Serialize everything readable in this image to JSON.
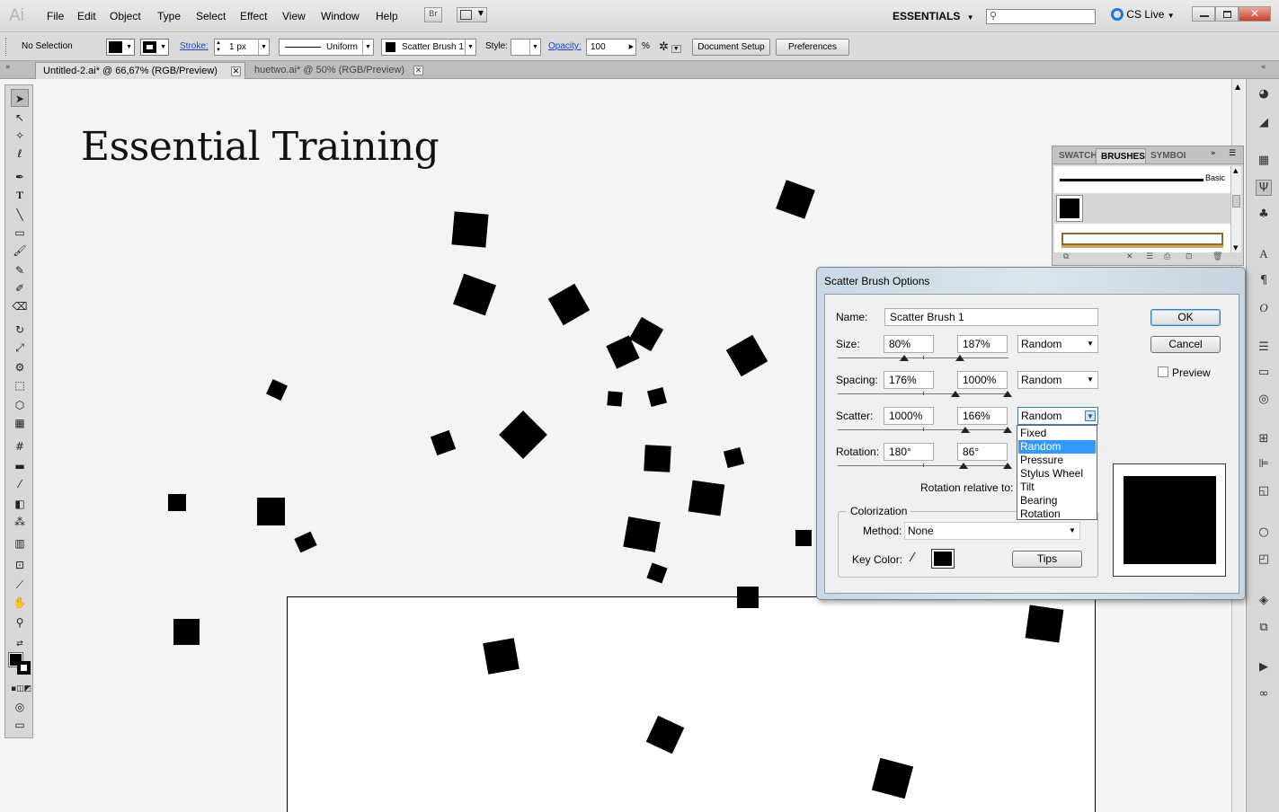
{
  "app": {
    "logo": "Ai"
  },
  "menu": [
    "File",
    "Edit",
    "Object",
    "Type",
    "Select",
    "Effect",
    "View",
    "Window",
    "Help"
  ],
  "menu_right": {
    "bridge": "Br",
    "workspace": "ESSENTIALS",
    "search_placeholder": "",
    "cslive": "CS Live"
  },
  "control": {
    "selection": "No Selection",
    "stroke_label": "Stroke:",
    "stroke_weight": "1 px",
    "profile": "Uniform",
    "brush": "Scatter Brush 1",
    "style_label": "Style:",
    "opacity_label": "Opacity:",
    "opacity_value": "100",
    "opacity_unit": "%",
    "document_setup": "Document Setup",
    "preferences": "Preferences"
  },
  "tabs": [
    {
      "label": "Untitled-2.ai* @ 66,67% (RGB/Preview)",
      "active": true
    },
    {
      "label": "huetwo.ai* @ 50% (RGB/Preview)",
      "active": false
    }
  ],
  "canvas": {
    "title_text": "Essential Training"
  },
  "brushes_panel": {
    "tabs": [
      "SWATCH",
      "BRUSHES",
      "SYMBOL"
    ],
    "basic_label": "Basic"
  },
  "dialog": {
    "title": "Scatter Brush Options",
    "name_label": "Name:",
    "name_value": "Scatter Brush 1",
    "size_label": "Size:",
    "size_min": "80%",
    "size_max": "187%",
    "size_mode": "Random",
    "spacing_label": "Spacing:",
    "spacing_min": "176%",
    "spacing_max": "1000%",
    "spacing_mode": "Random",
    "scatter_label": "Scatter:",
    "scatter_min": "1000%",
    "scatter_max": "166%",
    "scatter_mode": "Random",
    "rotation_label": "Rotation:",
    "rotation_min": "180°",
    "rotation_max": "86°",
    "rotation_relative_label": "Rotation relative to:",
    "colorization_label": "Colorization",
    "method_label": "Method:",
    "method_value": "None",
    "key_color_label": "Key Color:",
    "tips": "Tips",
    "ok": "OK",
    "cancel": "Cancel",
    "preview": "Preview",
    "preview_checked": false
  },
  "dropdown_options": [
    "Fixed",
    "Random",
    "Pressure",
    "Stylus Wheel",
    "Tilt",
    "Bearing",
    "Rotation"
  ],
  "dropdown_selected": "Random",
  "colors": {
    "dialog_frame": "#c9d7e4",
    "link": "#1a45c8",
    "highlight": "#3399ff",
    "canvas": "#f4f4f4"
  }
}
